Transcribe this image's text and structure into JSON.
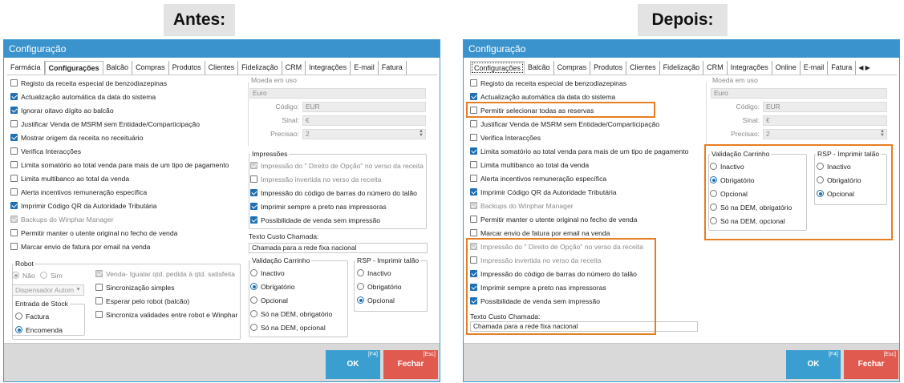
{
  "before": {
    "banner": "Antes:",
    "window_title": "Configuração",
    "tabs": [
      "Farmácia",
      "Configurações",
      "Balcão",
      "Compras",
      "Produtos",
      "Clientes",
      "Fidelização",
      "CRM",
      "Integrações",
      "E-mail",
      "Fatura"
    ],
    "left_options": [
      {
        "label": "Registo da receita especial de benzodiazepinas",
        "state": "off"
      },
      {
        "label": "Actualização automática da data do sistema",
        "state": "on"
      },
      {
        "label": "Ignorar oitavo dígito ao balcão",
        "state": "on"
      },
      {
        "label": "Justificar Venda de MSRM sem Entidade/Comparticipação",
        "state": "off"
      },
      {
        "label": "Mostrar origem da receita no receituário",
        "state": "on"
      },
      {
        "label": "Verifica Interacções",
        "state": "off"
      },
      {
        "label": "Limita somatório ao total venda para mais de um tipo de pagamento",
        "state": "off"
      },
      {
        "label": "Limita multibanco ao total da venda",
        "state": "off"
      },
      {
        "label": "Alerta incentivos remuneração específica",
        "state": "off"
      },
      {
        "label": "Imprimir Código QR da Autoridade Tributária",
        "state": "on"
      },
      {
        "label": "Backups do Winphar Manager",
        "state": "disabled"
      },
      {
        "label": "Permitir manter o utente original no fecho de venda",
        "state": "off"
      },
      {
        "label": "Marcar envio de fatura por email na venda",
        "state": "off"
      }
    ],
    "robot": {
      "title": "Robot",
      "no": "Não",
      "yes": "Sim",
      "dispenser": "Dispensador Autom",
      "stock_title": "Entrada de Stock",
      "stock_options": [
        "Factura",
        "Encomenda"
      ],
      "options": [
        {
          "label": "Venda- Igualar qtd. pedida à qtd. satisfeita",
          "state": "disabled"
        },
        {
          "label": "Sincronização simples",
          "state": "off"
        },
        {
          "label": "Esperar pelo robot (balcão)",
          "state": "off"
        },
        {
          "label": "Sincroniza validades entre robot e Winphar",
          "state": "off"
        }
      ]
    },
    "currency": {
      "title": "Moeda em uso",
      "name": "Euro",
      "code_label": "Código:",
      "code": "EUR",
      "sign_label": "Sinal:",
      "sign": "€",
      "precision_label": "Precisao:",
      "precision": "2"
    },
    "prints": {
      "title": "Impressões",
      "options": [
        {
          "label": "Impressão do \" Direito de Opção\" no verso da receita",
          "state": "disabled"
        },
        {
          "label": "Impressão invertida no verso da receita",
          "state": "off-disabled"
        },
        {
          "label": "Impressão do código de barras do número do talão",
          "state": "on"
        },
        {
          "label": "Imprimir sempre a preto nas impressoras",
          "state": "on"
        },
        {
          "label": "Possibilidade de venda sem impressão",
          "state": "on"
        }
      ]
    },
    "custo_label": "Texto Custo Chamada:",
    "custo_value": "Chamada para a rede fixa nacional",
    "validation": {
      "title": "Validação Carrinho",
      "options": [
        "Inactivo",
        "Obrigatório",
        "Opcional",
        "Só na DEM, obrigatório",
        "Só na DEM, opcional"
      ]
    },
    "rsp": {
      "title": "RSP - Imprimir talão",
      "options": [
        "Inactivo",
        "Obrigatório",
        "Opcional"
      ]
    },
    "ok": "OK",
    "ok_key": "[F4]",
    "close": "Fechar",
    "close_key": "[Esc]"
  },
  "after": {
    "banner": "Depois:",
    "window_title": "Configuração",
    "tabs": [
      "Configurações",
      "Balcão",
      "Compras",
      "Produtos",
      "Clientes",
      "Fidelização",
      "CRM",
      "Integrações",
      "Online",
      "E-mail",
      "Fatura"
    ],
    "left_options": [
      {
        "label": "Registo da receita especial de benzodiazepinas",
        "state": "off"
      },
      {
        "label": "Actualização automática da data do sistema",
        "state": "on"
      },
      {
        "label": "Permitir selecionar todas as reservas",
        "state": "off"
      },
      {
        "label": "Justificar Venda de MSRM sem Entidade/Comparticipação",
        "state": "off"
      },
      {
        "label": "Verifica Interacções",
        "state": "off"
      },
      {
        "label": "Limita somatório ao total venda para mais de um tipo de pagamento",
        "state": "on"
      },
      {
        "label": "Limita multibanco ao total da venda",
        "state": "off"
      },
      {
        "label": "Alerta incentivos remuneração específica",
        "state": "off"
      },
      {
        "label": "Imprimir Código QR da Autoridade Tributária",
        "state": "on"
      },
      {
        "label": "Backups do Winphar Manager",
        "state": "disabled"
      },
      {
        "label": "Permitir manter o utente original no fecho de venda",
        "state": "off"
      },
      {
        "label": "Marcar envio de fatura por email na venda",
        "state": "off"
      },
      {
        "label": "Impressão do \" Direito de Opção\" no verso da receita",
        "state": "disabled"
      },
      {
        "label": "Impressão invertida no verso da receita",
        "state": "off-disabled"
      },
      {
        "label": "Impressão do código de barras do número do talão",
        "state": "on"
      },
      {
        "label": "Imprimir sempre a preto nas impressoras",
        "state": "on"
      },
      {
        "label": "Possibilidade de venda sem impressão",
        "state": "on"
      }
    ],
    "custo_label": "Texto Custo Chamada:",
    "custo_value": "Chamada para a rede fixa nacional",
    "currency": {
      "title": "Moeda em uso",
      "name": "Euro",
      "code_label": "Código:",
      "code": "EUR",
      "sign_label": "Sinal:",
      "sign": "€",
      "precision_label": "Precisao:",
      "precision": "2"
    },
    "validation": {
      "title": "Validação Carrinho",
      "options": [
        "Inactivo",
        "Obrigatório",
        "Opcional",
        "Só na DEM, obrigatório",
        "Só na DEM, opcional"
      ]
    },
    "rsp": {
      "title": "RSP - Imprimir talão",
      "options": [
        "Inactivo",
        "Obrigatório",
        "Opcional"
      ]
    },
    "tab_arrows": "◀ ▶",
    "ok": "OK",
    "ok_key": "[F4]",
    "close": "Fechar",
    "close_key": "[Esc]"
  },
  "colors": {
    "title_bar": "#3a93cc",
    "checked": "#1f6fb4",
    "highlight": "#e67e22",
    "ok_button": "#3a9fd0",
    "close_button": "#e05a4f"
  }
}
